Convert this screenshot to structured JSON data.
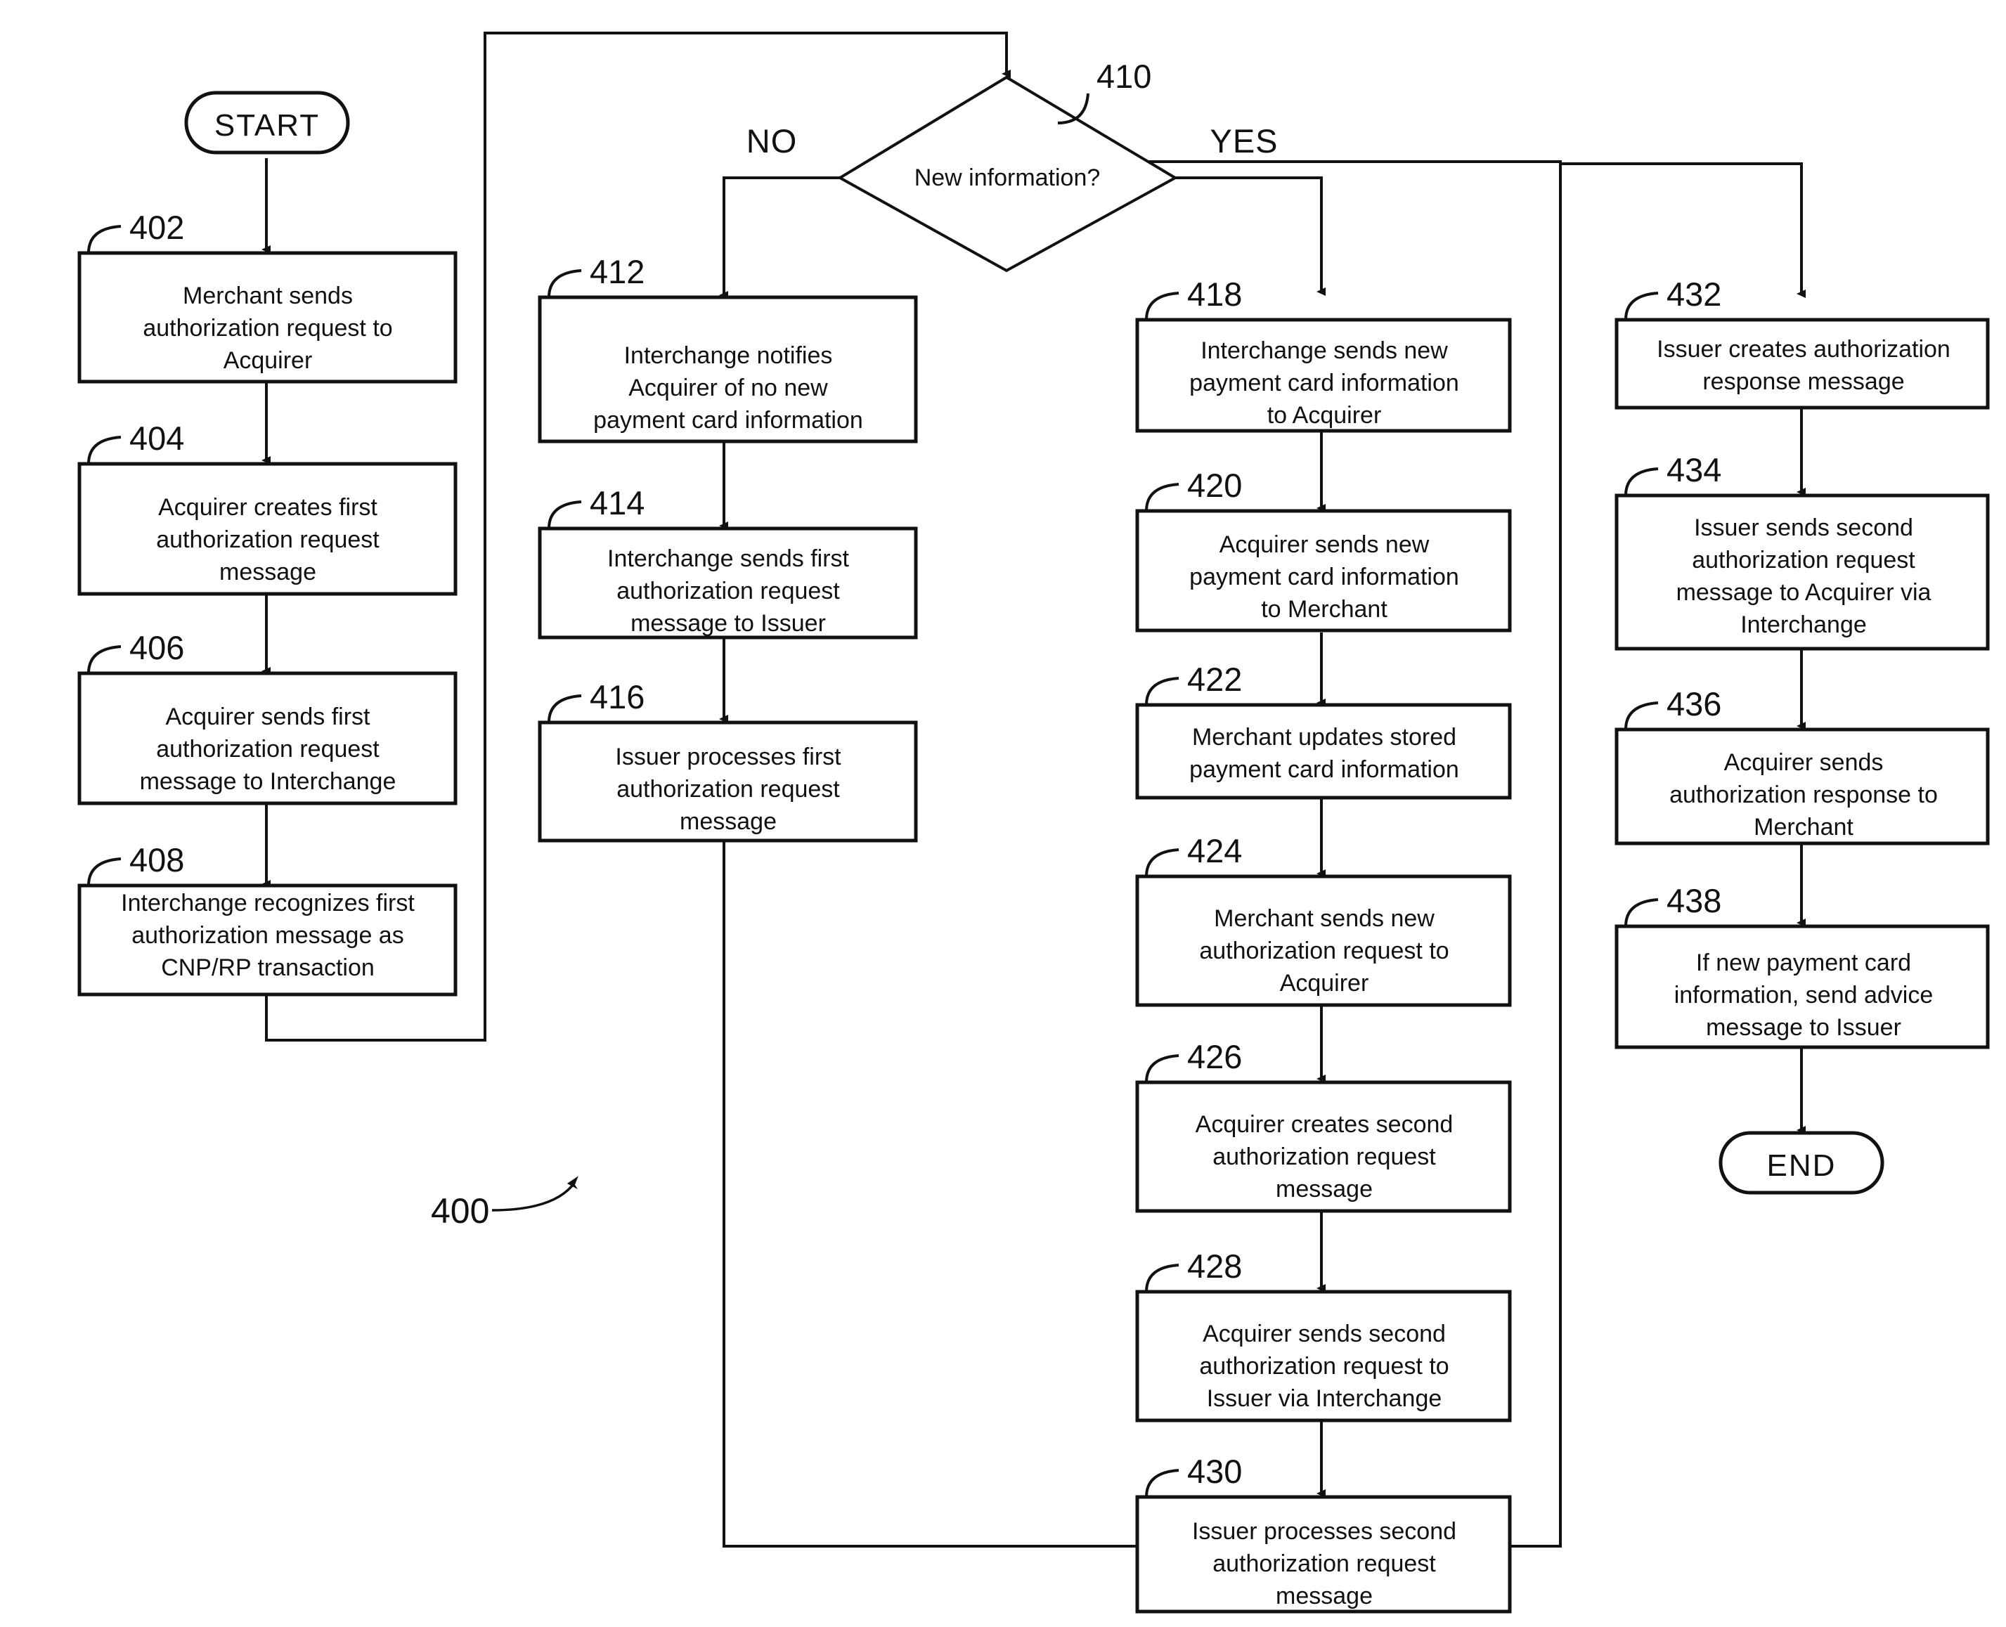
{
  "figure": {
    "label": "400",
    "terminators": {
      "start": "START",
      "end": "END"
    },
    "decision": {
      "ref": "410",
      "text": "New information?",
      "branch_no": "NO",
      "branch_yes": "YES"
    },
    "columns": {
      "left": [
        {
          "ref": "402",
          "lines": [
            "Merchant sends",
            "authorization request to",
            "Acquirer"
          ]
        },
        {
          "ref": "404",
          "lines": [
            "Acquirer creates first",
            "authorization request",
            "message"
          ]
        },
        {
          "ref": "406",
          "lines": [
            "Acquirer sends first",
            "authorization request",
            "message to Interchange"
          ]
        },
        {
          "ref": "408",
          "lines": [
            "Interchange recognizes first",
            "authorization message as",
            "CNP/RP transaction"
          ]
        }
      ],
      "no_branch": [
        {
          "ref": "412",
          "lines": [
            "Interchange notifies",
            "Acquirer of no new",
            "payment card information"
          ]
        },
        {
          "ref": "414",
          "lines": [
            "Interchange sends first",
            "authorization request",
            "message to Issuer"
          ]
        },
        {
          "ref": "416",
          "lines": [
            "Issuer processes first",
            "authorization request",
            "message"
          ]
        }
      ],
      "yes_branch": [
        {
          "ref": "418",
          "lines": [
            "Interchange sends new",
            "payment card information",
            "to Acquirer"
          ]
        },
        {
          "ref": "420",
          "lines": [
            "Acquirer sends new",
            "payment card information",
            "to Merchant"
          ]
        },
        {
          "ref": "422",
          "lines": [
            "Merchant updates stored",
            "payment card information"
          ]
        },
        {
          "ref": "424",
          "lines": [
            "Merchant sends new",
            "authorization request to",
            "Acquirer"
          ]
        },
        {
          "ref": "426",
          "lines": [
            "Acquirer creates second",
            "authorization request",
            "message"
          ]
        },
        {
          "ref": "428",
          "lines": [
            "Acquirer sends second",
            "authorization request to",
            "Issuer via Interchange"
          ]
        },
        {
          "ref": "430",
          "lines": [
            "Issuer processes second",
            "authorization request",
            "message"
          ]
        }
      ],
      "right": [
        {
          "ref": "432",
          "lines": [
            "Issuer creates authorization",
            "response message"
          ]
        },
        {
          "ref": "434",
          "lines": [
            "Issuer sends second",
            "authorization request",
            "message to Acquirer via",
            "Interchange"
          ]
        },
        {
          "ref": "436",
          "lines": [
            "Acquirer sends",
            "authorization response to",
            "Merchant"
          ]
        },
        {
          "ref": "438",
          "lines": [
            "If new payment card",
            "information, send advice",
            "message to Issuer"
          ]
        }
      ]
    }
  }
}
